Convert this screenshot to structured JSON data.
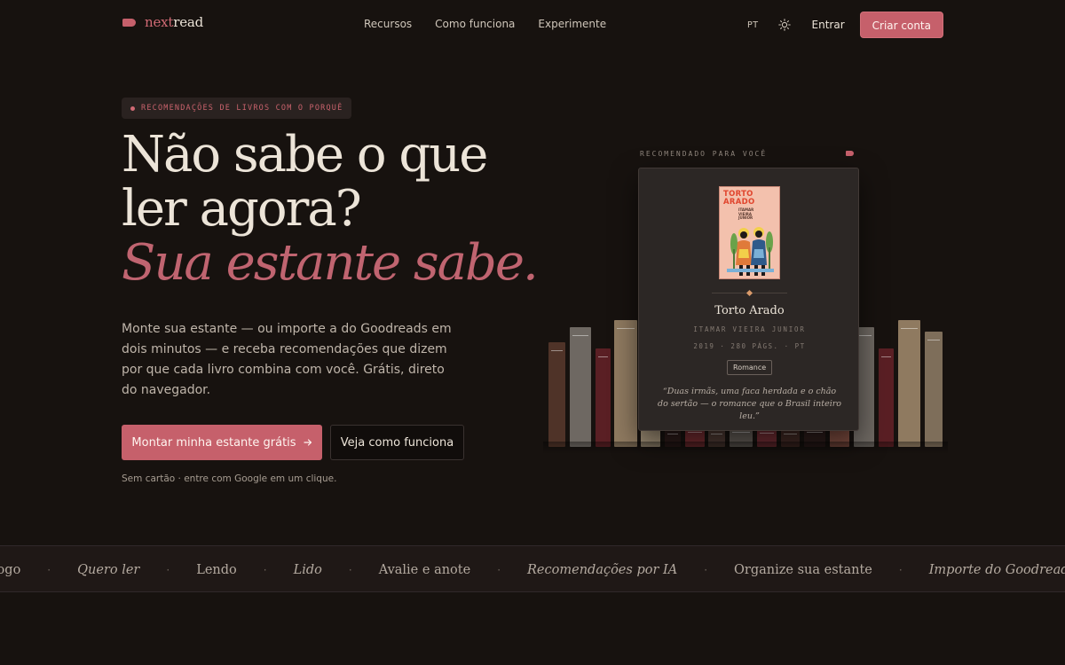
{
  "brand": {
    "name_a": "next",
    "name_b": "read",
    "accent_color": "#c6606b"
  },
  "nav": {
    "links": [
      "Recursos",
      "Como funciona",
      "Experimente"
    ],
    "language": "PT",
    "theme_icon": "sun-icon",
    "login_label": "Entrar",
    "signup_label": "Criar conta"
  },
  "hero": {
    "badge": "RECOMENDAÇÕES DE LIVROS COM O PORQUÊ",
    "title_line1": "Não sabe o que",
    "title_line2": "ler agora?",
    "title_accent": "Sua estante sabe.",
    "description": "Monte sua estante — ou importe a do Goodreads em dois minutos — e receba recomendações que dizem por que cada livro combina com você. Grátis, direto do navegador.",
    "primary_cta": "Montar minha estante grátis",
    "primary_cta_icon": "arrow-right-icon",
    "secondary_cta": "Veja como funciona",
    "note": "Sem cartão · entre com Google em um clique."
  },
  "recommendation": {
    "label": "RECOMENDADO PARA VOCÊ",
    "cover_title": "TORTO ARADO",
    "cover_author": "ITAMAR VIEIRA JUNIOR",
    "title": "Torto Arado",
    "author": "ITAMAR VIEIRA JUNIOR",
    "meta": "2019 · 280 PÁGS. · PT",
    "genre": "Romance",
    "quote": "“Duas irmãs, uma faca herdada e o chão do sertão — o romance que o Brasil inteiro leu.”"
  },
  "marquee": {
    "items": [
      {
        "text": "no catálogo",
        "italic": false
      },
      {
        "text": "Quero ler",
        "italic": true
      },
      {
        "text": "Lendo",
        "italic": false
      },
      {
        "text": "Lido",
        "italic": true
      },
      {
        "text": "Avalie e anote",
        "italic": false
      },
      {
        "text": "Recomendações por IA",
        "italic": true
      },
      {
        "text": "Organize sua estante",
        "italic": false
      },
      {
        "text": "Importe do Goodreads",
        "italic": true
      }
    ],
    "separator": "·"
  }
}
